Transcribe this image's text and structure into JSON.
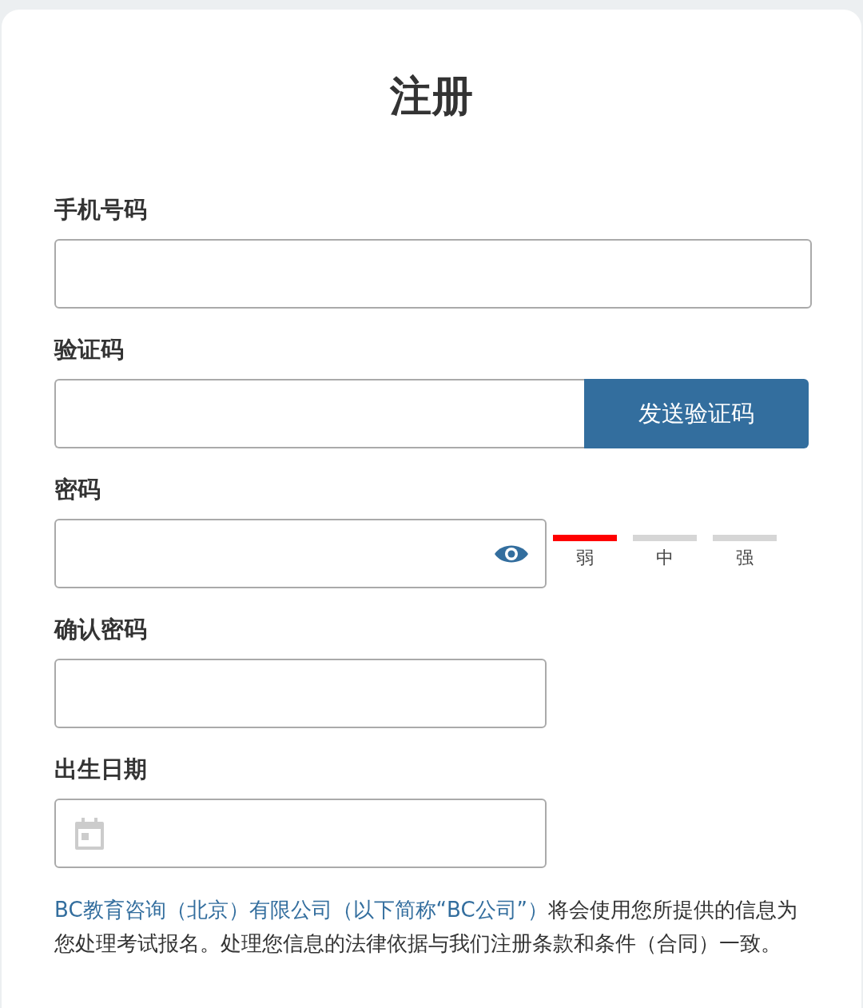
{
  "title": "注册",
  "fields": [
    {
      "kind": "text",
      "label": "手机号码"
    },
    {
      "kind": "code",
      "label": "验证码",
      "button": "发送验证码"
    },
    {
      "kind": "password",
      "label": "密码",
      "strength": [
        {
          "label": "弱",
          "on": true
        },
        {
          "label": "中",
          "on": false
        },
        {
          "label": "强",
          "on": false
        }
      ]
    },
    {
      "kind": "short",
      "label": "确认密码"
    },
    {
      "kind": "date",
      "label": "出生日期"
    }
  ],
  "notice": {
    "link": "BC教育咨询（北京）有限公司（以下简称“BC公司”）",
    "text": "将会使用您所提供的信息为您处理考试报名。处理您信息的法律依据与我们注册条款和条件（合同）一致。"
  }
}
